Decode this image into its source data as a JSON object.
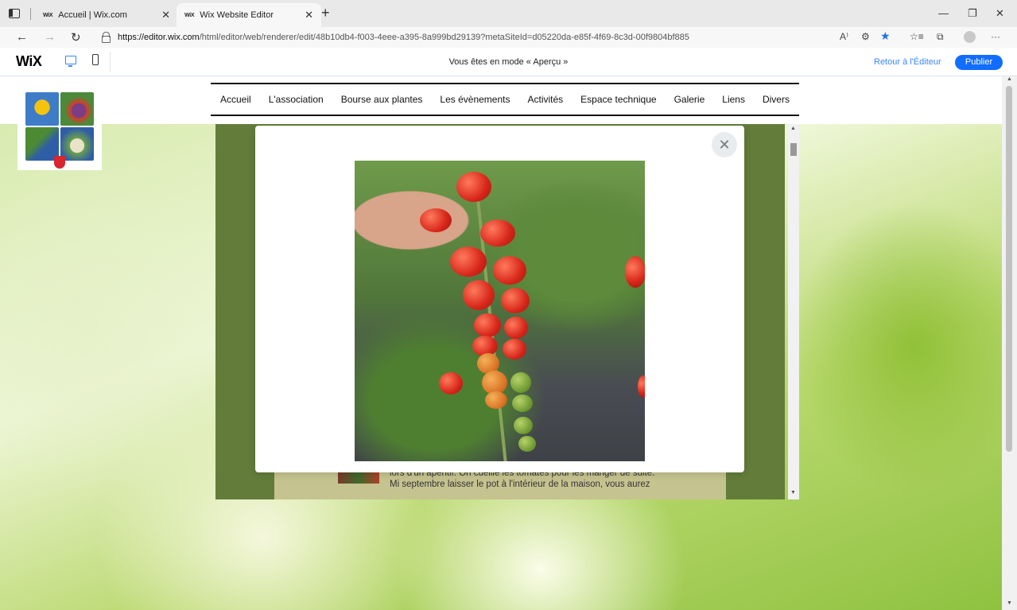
{
  "browser": {
    "tabs": [
      {
        "favicon": "WiX",
        "title": "Accueil | Wix.com",
        "close": "✕"
      },
      {
        "favicon": "WiX",
        "title": "Wix Website Editor",
        "close": "✕"
      }
    ],
    "new_tab": "+",
    "window_controls": {
      "minimize": "—",
      "restore": "❐",
      "close": "✕"
    },
    "nav": {
      "back": "←",
      "forward": "→",
      "reload": "↻"
    },
    "url_host": "https://editor.wix.com",
    "url_path": "/html/editor/web/renderer/edit/48b10db4-f003-4eee-a395-8a999bd29139?metaSiteId=d05220da-e85f-4f69-8c3d-00f9804bf885",
    "toolbar_icons": {
      "read_aloud": "A⁾",
      "extensions": "⚙",
      "favorite": "★",
      "favorites": "☆≡",
      "collections": "⧉",
      "menu": "···"
    }
  },
  "wix_bar": {
    "logo": "WiX",
    "preview_message": "Vous êtes en mode « Aperçu »",
    "back_to_editor": "Retour à l'Éditeur",
    "publish": "Publier",
    "accent_color": "#116dff"
  },
  "site": {
    "nav": [
      "Accueil",
      "L'association",
      "Bourse aux plantes",
      "Les évènements",
      "Activités",
      "Espace technique",
      "Galerie",
      "Liens",
      "Divers"
    ],
    "content_lines": [
      "lors d'un apéritif. On cueille les tomates pour les manger de suite.",
      "Mi septembre laisser le pot à l'intérieur de la maison, vous aurez"
    ]
  },
  "lightbox": {
    "close": "✕"
  }
}
